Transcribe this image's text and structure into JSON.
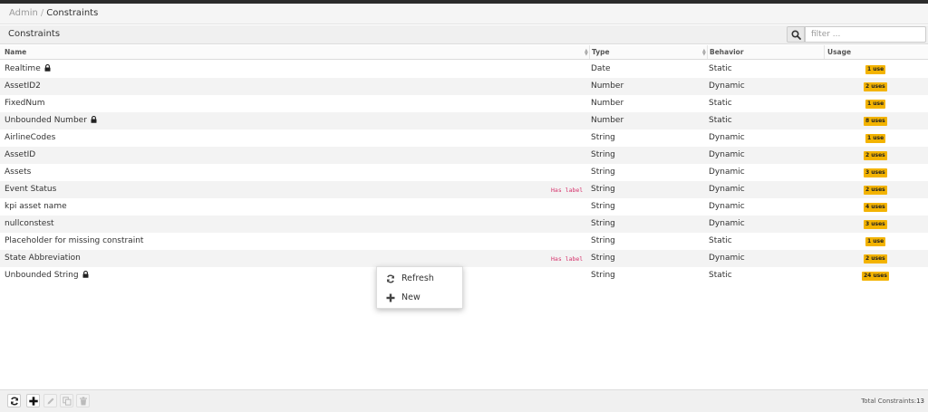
{
  "breadcrumb": {
    "parent": "Admin",
    "separator": "/",
    "current": "Constraints"
  },
  "panel": {
    "title": "Constraints"
  },
  "search": {
    "placeholder": "filter ..."
  },
  "columns": {
    "name": "Name",
    "type": "Type",
    "behavior": "Behavior",
    "usage": "Usage"
  },
  "rows": [
    {
      "name": "Realtime",
      "locked": true,
      "has_label": "",
      "type": "Date",
      "behavior": "Static",
      "usage": "1 use"
    },
    {
      "name": "AssetID2",
      "locked": false,
      "has_label": "",
      "type": "Number",
      "behavior": "Dynamic",
      "usage": "2 uses"
    },
    {
      "name": "FixedNum",
      "locked": false,
      "has_label": "",
      "type": "Number",
      "behavior": "Static",
      "usage": "1 use"
    },
    {
      "name": "Unbounded Number",
      "locked": true,
      "has_label": "",
      "type": "Number",
      "behavior": "Static",
      "usage": "8 uses"
    },
    {
      "name": "AirlineCodes",
      "locked": false,
      "has_label": "",
      "type": "String",
      "behavior": "Dynamic",
      "usage": "1 use"
    },
    {
      "name": "AssetID",
      "locked": false,
      "has_label": "",
      "type": "String",
      "behavior": "Dynamic",
      "usage": "2 uses"
    },
    {
      "name": "Assets",
      "locked": false,
      "has_label": "",
      "type": "String",
      "behavior": "Dynamic",
      "usage": "3 uses"
    },
    {
      "name": "Event Status",
      "locked": false,
      "has_label": "Has label",
      "type": "String",
      "behavior": "Dynamic",
      "usage": "2 uses"
    },
    {
      "name": "kpi asset name",
      "locked": false,
      "has_label": "",
      "type": "String",
      "behavior": "Dynamic",
      "usage": "4 uses"
    },
    {
      "name": "nullconstest",
      "locked": false,
      "has_label": "",
      "type": "String",
      "behavior": "Dynamic",
      "usage": "3 uses"
    },
    {
      "name": "Placeholder for missing constraint",
      "locked": false,
      "has_label": "",
      "type": "String",
      "behavior": "Static",
      "usage": "1 use"
    },
    {
      "name": "State Abbreviation",
      "locked": false,
      "has_label": "Has label",
      "type": "String",
      "behavior": "Dynamic",
      "usage": "2 uses"
    },
    {
      "name": "Unbounded String",
      "locked": true,
      "has_label": "",
      "type": "String",
      "behavior": "Static",
      "usage": "24 uses"
    }
  ],
  "context_menu": {
    "refresh_label": "Refresh",
    "new_label": "New"
  },
  "footer": {
    "total_label": "Total Constraints:",
    "total_value": "13"
  },
  "colors": {
    "badge": "#f3b300",
    "has_label": "#d6336c",
    "stripe": "#f3f3f3"
  },
  "icons": {
    "search": "search-icon",
    "lock": "lock-icon",
    "refresh": "refresh-icon",
    "add": "plus-icon",
    "edit": "pencil-icon",
    "copy": "copy-icon",
    "delete": "trash-icon"
  }
}
